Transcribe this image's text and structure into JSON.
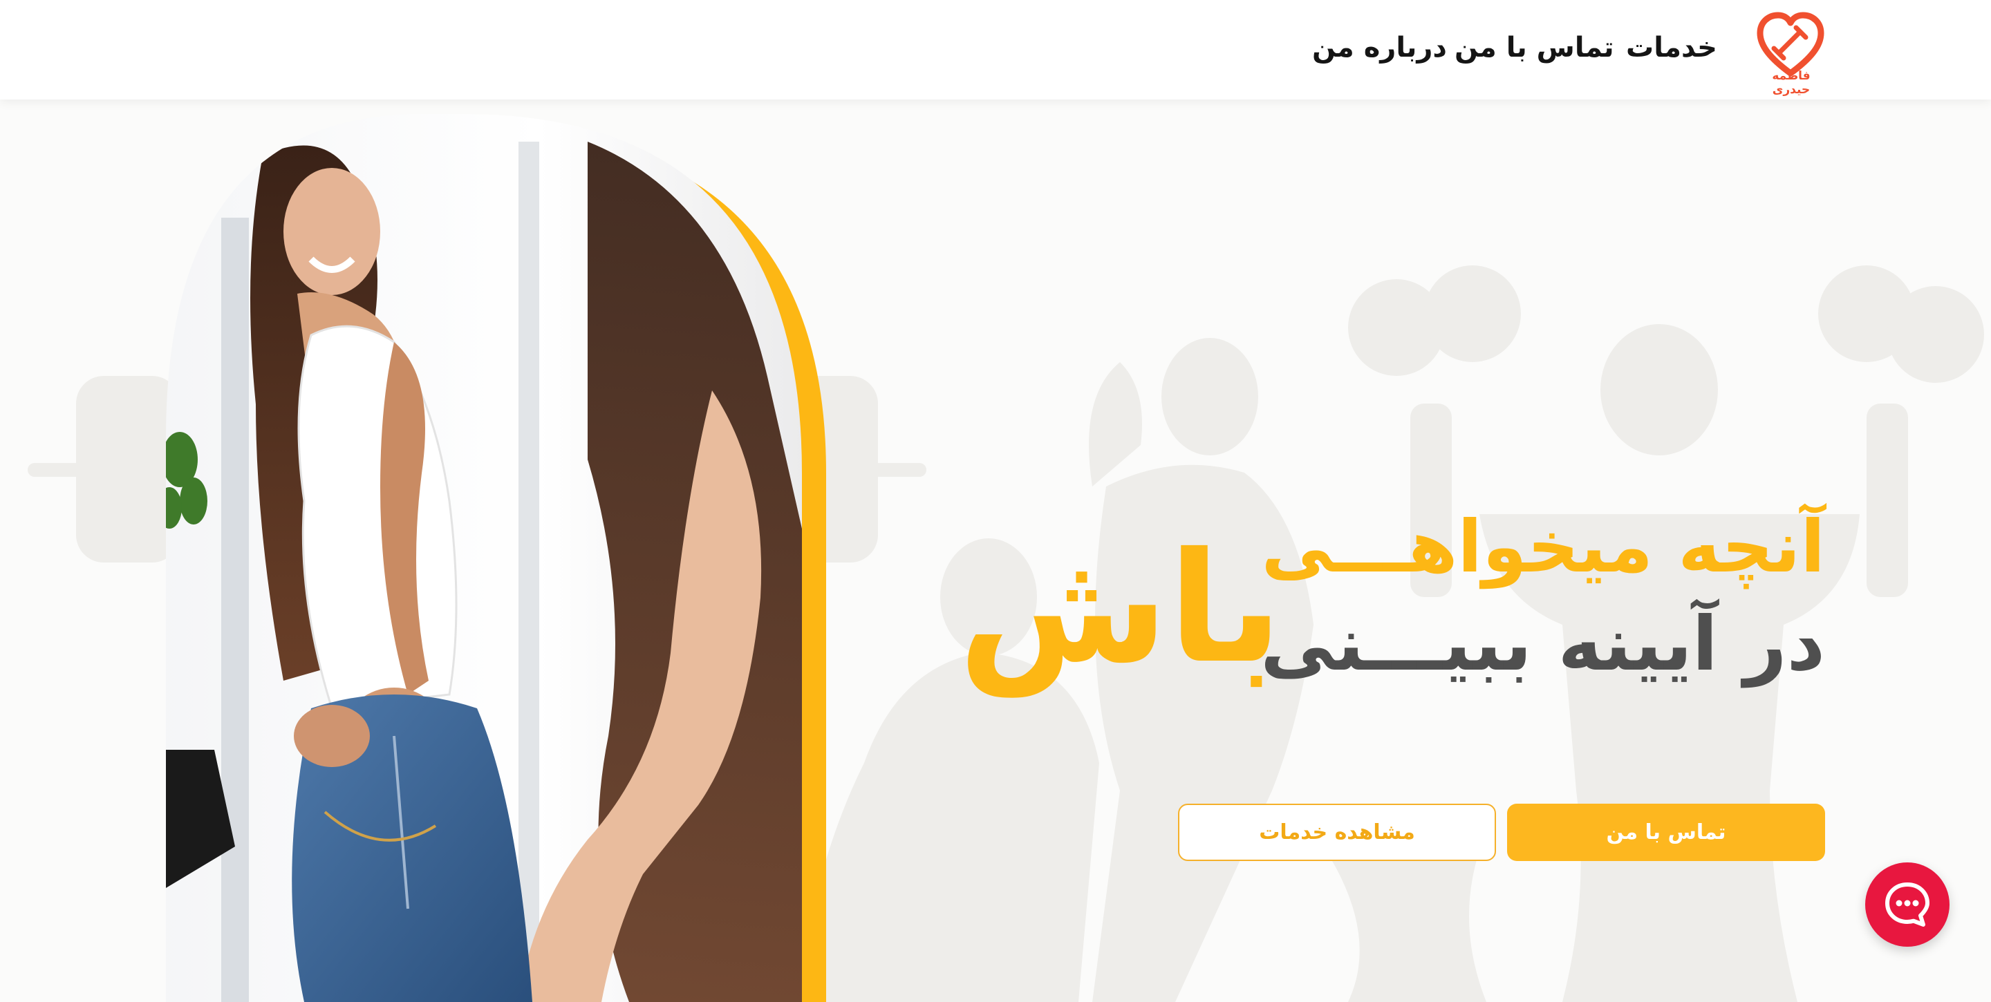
{
  "header": {
    "logo_caption": "فاطمه حیدری",
    "nav": {
      "services": "خدمات",
      "contact": "تماس با من",
      "about": "درباره من"
    }
  },
  "hero": {
    "headline_line1": "آنچه میخواهـــی",
    "headline_line2": "در آیینه ببیـــنی",
    "headline_big": "باش",
    "primary_button": "تماس با من",
    "secondary_button": "مشاهده خدمات"
  },
  "colors": {
    "accent": "#fdb714",
    "headline_gray": "#4f4f4f",
    "logo": "#f0502f",
    "chat": "#e8173f"
  },
  "icons": {
    "logo": "heart-dumbbell-icon",
    "chat": "chat-bubble-icon"
  }
}
